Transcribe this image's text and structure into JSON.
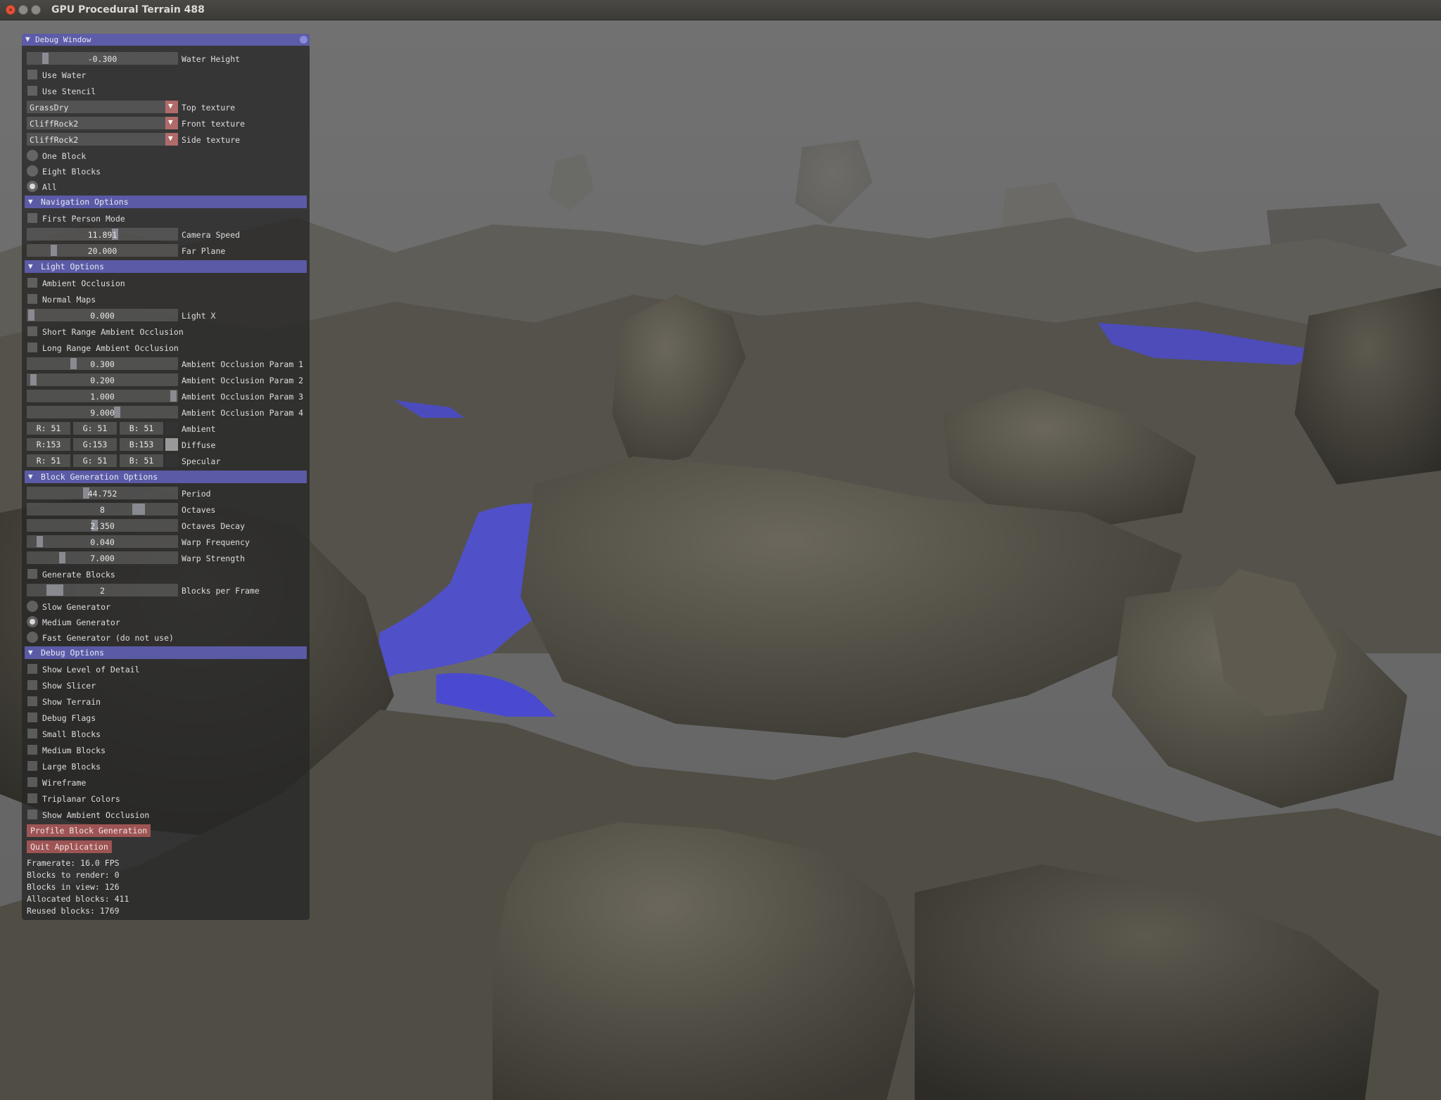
{
  "window": {
    "title": "GPU Procedural Terrain 488"
  },
  "debug_window": {
    "title": "Debug Window",
    "water_height": {
      "value": "-0.300",
      "label": "Water Height"
    },
    "use_water": "Use Water",
    "use_stencil": "Use Stencil",
    "top_texture": {
      "value": "GrassDry",
      "label": "Top texture"
    },
    "front_texture": {
      "value": "CliffRock2",
      "label": "Front texture"
    },
    "side_texture": {
      "value": "CliffRock2",
      "label": "Side texture"
    },
    "radio_one_block": "One Block",
    "radio_eight_blocks": "Eight Blocks",
    "radio_all": "All"
  },
  "navigation": {
    "header": "Navigation Options",
    "first_person": "First Person Mode",
    "camera_speed": {
      "value": "11.891",
      "label": "Camera Speed"
    },
    "far_plane": {
      "value": "20.000",
      "label": "Far Plane"
    }
  },
  "light": {
    "header": "Light Options",
    "ambient_occlusion": "Ambient Occlusion",
    "normal_maps": "Normal Maps",
    "light_x": {
      "value": "0.000",
      "label": "Light X"
    },
    "short_range_ao": "Short Range Ambient Occlusion",
    "long_range_ao": "Long Range Ambient Occlusion",
    "ao_param1": {
      "value": "0.300",
      "label": "Ambient Occlusion Param 1"
    },
    "ao_param2": {
      "value": "0.200",
      "label": "Ambient Occlusion Param 2"
    },
    "ao_param3": {
      "value": "1.000",
      "label": "Ambient Occlusion Param 3"
    },
    "ao_param4": {
      "value": "9.000",
      "label": "Ambient Occlusion Param 4"
    },
    "ambient": {
      "r": "R: 51",
      "g": "G: 51",
      "b": "B: 51",
      "label": "Ambient",
      "color": "#333333"
    },
    "diffuse": {
      "r": "R:153",
      "g": "G:153",
      "b": "B:153",
      "label": "Diffuse",
      "color": "#999999"
    },
    "specular": {
      "r": "R: 51",
      "g": "G: 51",
      "b": "B: 51",
      "label": "Specular",
      "color": "#333333"
    }
  },
  "block_gen": {
    "header": "Block Generation Options",
    "period": {
      "value": "44.752",
      "label": "Period"
    },
    "octaves": {
      "value": "8",
      "label": "Octaves"
    },
    "octaves_decay": {
      "value": "2.350",
      "label": "Octaves Decay"
    },
    "warp_frequency": {
      "value": "0.040",
      "label": "Warp Frequency"
    },
    "warp_strength": {
      "value": "7.000",
      "label": "Warp Strength"
    },
    "generate_blocks": "Generate Blocks",
    "blocks_per_frame": {
      "value": "2",
      "label": "Blocks per Frame"
    },
    "slow_generator": "Slow Generator",
    "medium_generator": "Medium Generator",
    "fast_generator": "Fast Generator (do not use)"
  },
  "debug": {
    "header": "Debug Options",
    "show_lod": "Show Level of Detail",
    "show_slicer": "Show Slicer",
    "show_terrain": "Show Terrain",
    "debug_flags": "Debug Flags",
    "small_blocks": "Small Blocks",
    "medium_blocks": "Medium Blocks",
    "large_blocks": "Large Blocks",
    "wireframe": "Wireframe",
    "triplanar": "Triplanar Colors",
    "show_ao": "Show Ambient Occlusion",
    "profile_button": "Profile Block Generation",
    "quit_button": "Quit Application"
  },
  "stats": {
    "framerate": "Framerate: 16.0 FPS",
    "blocks_to_render": "Blocks to render: 0",
    "blocks_in_view": "Blocks in view: 126",
    "allocated": "Allocated blocks: 411",
    "reused": "Reused blocks: 1769"
  },
  "colors": {
    "accent": "#5a5aa6",
    "button": "#9e5454",
    "water": "#4a4ad0"
  }
}
